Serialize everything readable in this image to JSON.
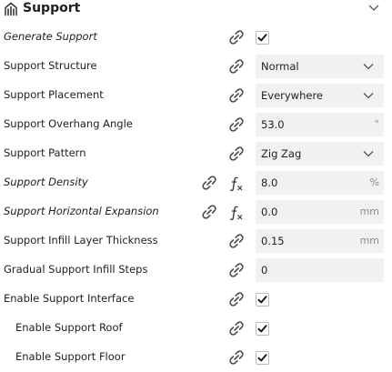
{
  "header": {
    "title": "Support",
    "icon": "support-category-icon"
  },
  "rows": [
    {
      "label": "Generate Support",
      "italic": true,
      "control": "checkbox",
      "checked": true
    },
    {
      "label": "Support Structure",
      "control": "dropdown",
      "value": "Normal"
    },
    {
      "label": "Support Placement",
      "control": "dropdown",
      "value": "Everywhere"
    },
    {
      "label": "Support Overhang Angle",
      "control": "text",
      "value": "53.0",
      "unit": "°"
    },
    {
      "label": "Support Pattern",
      "control": "dropdown",
      "value": "Zig Zag"
    },
    {
      "label": "Support Density",
      "italic": true,
      "fx": true,
      "control": "text",
      "value": "8.0",
      "unit": "%"
    },
    {
      "label": "Support Horizontal Expansion",
      "italic": true,
      "fx": true,
      "control": "text",
      "value": "0.0",
      "unit": "mm"
    },
    {
      "label": "Support Infill Layer Thickness",
      "control": "text",
      "value": "0.15",
      "unit": "mm"
    },
    {
      "label": "Gradual Support Infill Steps",
      "control": "text",
      "value": "0",
      "unit": ""
    },
    {
      "label": "Enable Support Interface",
      "control": "checkbox",
      "checked": true
    },
    {
      "label": "Enable Support Roof",
      "indent": true,
      "control": "checkbox",
      "checked": true
    },
    {
      "label": "Enable Support Floor",
      "indent": true,
      "control": "checkbox",
      "checked": true
    }
  ],
  "colors": {
    "field_bg": "#f1f1f1",
    "icon": "#4b4b4b",
    "unit": "#8a8a8a"
  }
}
